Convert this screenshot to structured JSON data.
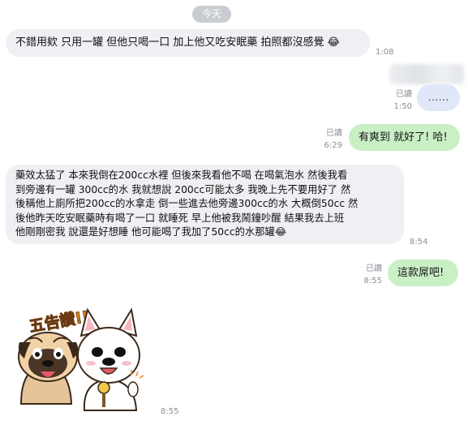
{
  "date_separator": "今天",
  "messages": [
    {
      "text": "不錯用欸 只用一罐 但他只喝一口 加上他又吃安眠藥 拍照都沒感覺 😂",
      "time": "1:08"
    },
    {
      "read": "已讀",
      "text": "……",
      "time": "1:50"
    },
    {
      "read": "已讀",
      "text": "有爽到 就好了! 哈!",
      "time": "6:29"
    },
    {
      "lines": [
        "藥效太猛了 本來我倒在200cc水裡 但後來我看他不喝 在喝氣泡水 然後我看",
        "到旁邊有一罐 300cc的水 我就想說 200cc可能太多 我晚上先不要用好了 然",
        "後稱他上廁所把200cc的水拿走 倒一些進去他旁邊300cc的水 大概倒50cc 然",
        "後他昨天吃安眠藥時有喝了一口 就睡死 早上他被我鬧鐘吵醒 結果我去上班",
        "他剛剛密我 說還是好想睡 他可能喝了我加了50cc的水那罐😂"
      ],
      "time": "8:54"
    },
    {
      "read": "已讀",
      "text": "這款屌吧!",
      "time": "8:55"
    },
    {
      "sticker_caption": "五告讚!!",
      "time": "8:55"
    }
  ],
  "colors": {
    "incoming": "#eef0f3",
    "outgoing": "#c9efc5",
    "pill": "#c9ccd1"
  },
  "icons": [
    "pug-sticker-icon",
    "bulldog-sticker-icon",
    "microphone-icon"
  ]
}
